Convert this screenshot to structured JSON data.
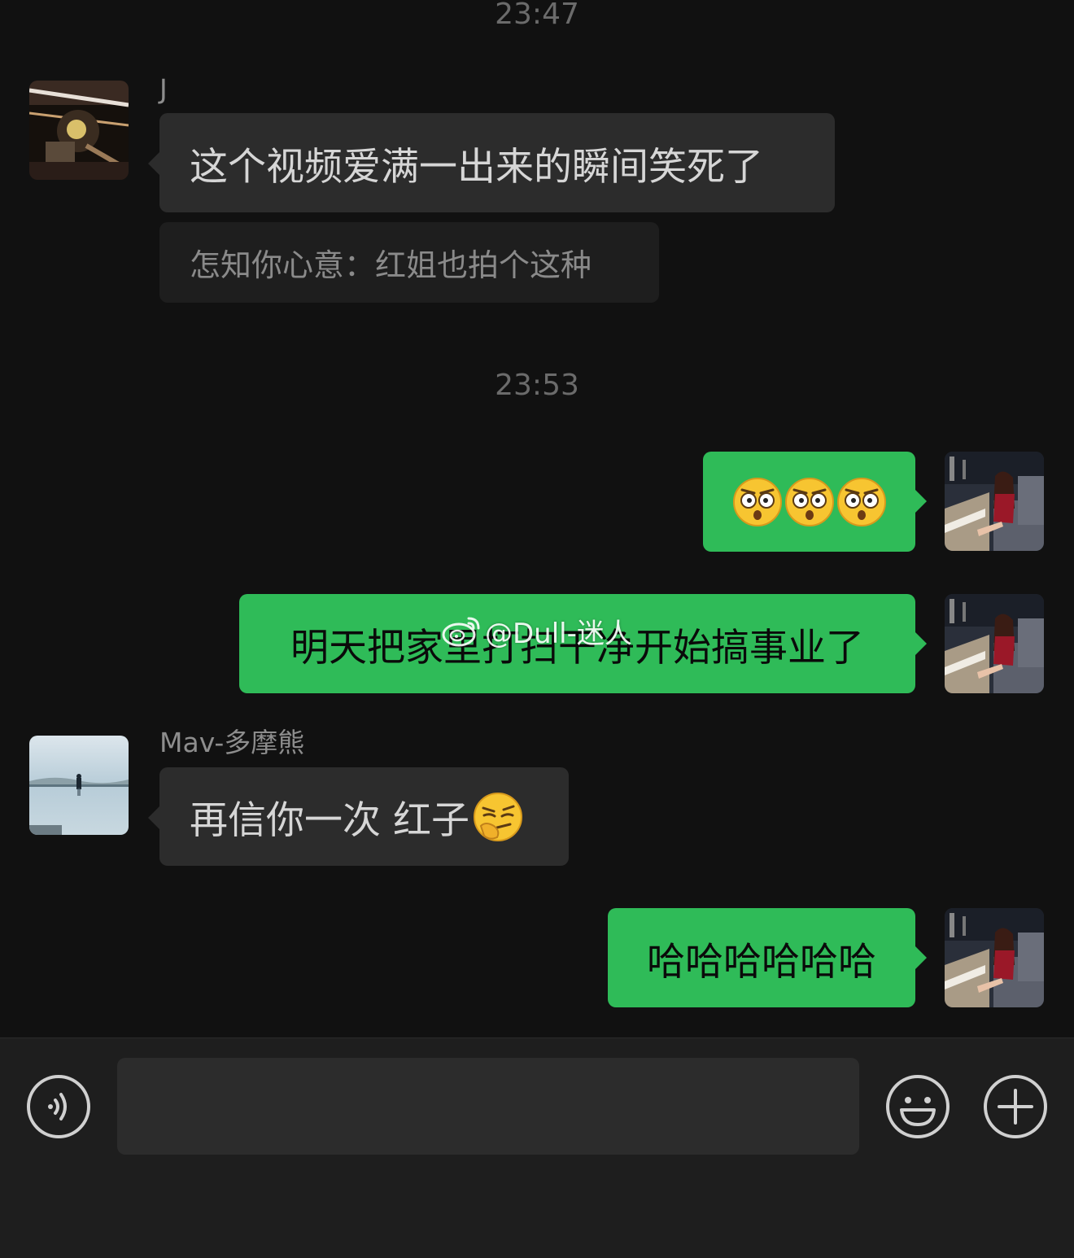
{
  "conversation": {
    "timestamps": [
      "23:47",
      "23:53"
    ],
    "messages": [
      {
        "sender": "J",
        "text": "这个视频爱满一出来的瞬间笑死了",
        "quote": "怎知你心意：红姐也拍个这种"
      },
      {
        "sender": "me",
        "emojis": [
          "wide-eyed-emoji",
          "wide-eyed-emoji",
          "wide-eyed-emoji"
        ]
      },
      {
        "sender": "me",
        "text": "明天把家里打扫干净开始搞事业了"
      },
      {
        "sender": "Mav-多摩熊",
        "text": "再信你一次 红子",
        "emoji": "thinking-smirk-emoji"
      },
      {
        "sender": "me",
        "text": "哈哈哈哈哈哈"
      }
    ]
  },
  "watermark": {
    "text": "@Dull-迷人",
    "icon": "weibo-icon"
  },
  "input_bar": {
    "voice_icon": "voice-icon",
    "emoji_icon": "smiley-icon",
    "plus_icon": "plus-icon",
    "value": ""
  },
  "colors": {
    "background": "#111111",
    "incoming_bubble": "#2c2c2c",
    "outgoing_bubble": "#2fbb58",
    "quote_bubble": "#1e1e1e",
    "timestamp": "#6b6b6b"
  }
}
